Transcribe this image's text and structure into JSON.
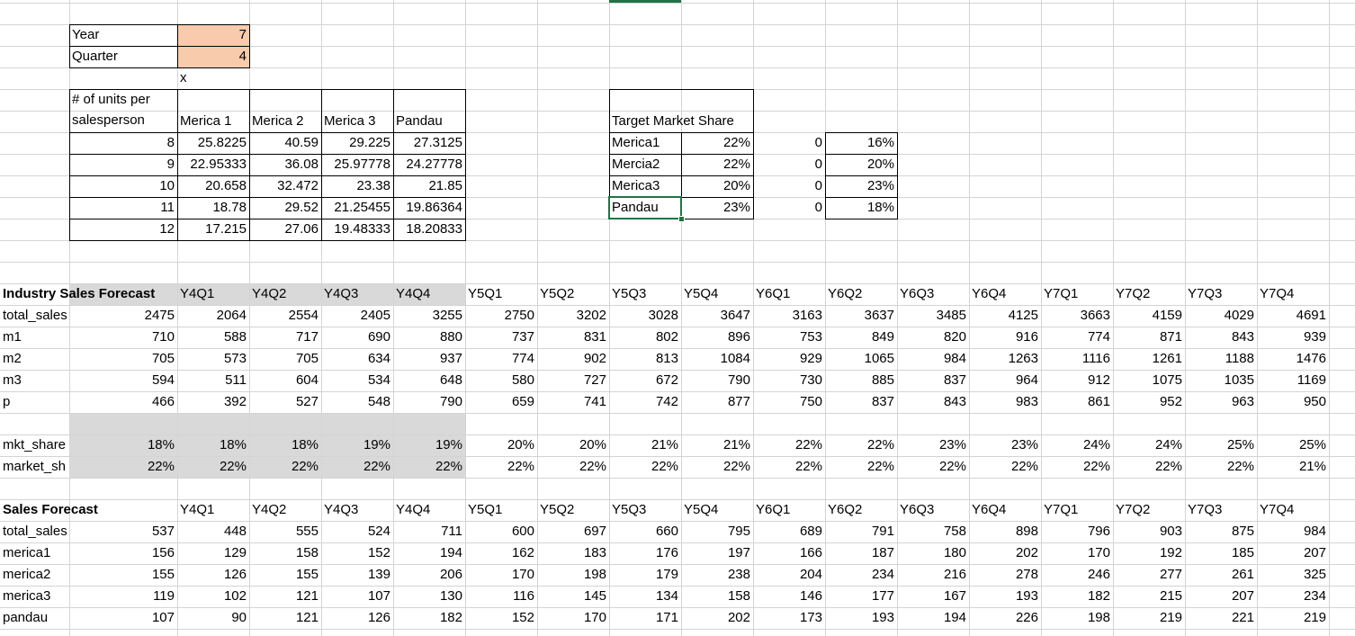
{
  "colors": {
    "input_fill": "#f8cbad",
    "gray_band": "#d9d9d9",
    "grid": "#d4d4d4",
    "selection": "#217346"
  },
  "inputs": {
    "year_label": "Year",
    "year_value": "7",
    "quarter_label": "Quarter",
    "quarter_value": "4",
    "x_marker": "x"
  },
  "units": {
    "header_label": "# of units per salesperson",
    "columns": [
      "Merica 1",
      "Merica 2",
      "Merica 3",
      "Pandau"
    ],
    "rows": [
      [
        "8",
        "25.8225",
        "40.59",
        "29.225",
        "27.3125"
      ],
      [
        "9",
        "22.95333",
        "36.08",
        "25.97778",
        "24.27778"
      ],
      [
        "10",
        "20.658",
        "32.472",
        "23.38",
        "21.85"
      ],
      [
        "11",
        "18.78",
        "29.52",
        "21.25455",
        "19.86364"
      ],
      [
        "12",
        "17.215",
        "27.06",
        "19.48333",
        "18.20833"
      ]
    ]
  },
  "target": {
    "title": "Target Market Share",
    "rows": [
      [
        "Merica1",
        "22%",
        "0",
        "16%"
      ],
      [
        "Mercia2",
        "22%",
        "0",
        "20%"
      ],
      [
        "Merica3",
        "20%",
        "0",
        "23%"
      ],
      [
        "Pandau",
        "23%",
        "0",
        "18%"
      ]
    ]
  },
  "industry": {
    "title": "Industry Sales Forecast",
    "headers": [
      "Y4Q1",
      "Y4Q2",
      "Y4Q3",
      "Y4Q4",
      "Y5Q1",
      "Y5Q2",
      "Y5Q3",
      "Y5Q4",
      "Y6Q1",
      "Y6Q2",
      "Y6Q3",
      "Y6Q4",
      "Y7Q1",
      "Y7Q2",
      "Y7Q3",
      "Y7Q4"
    ],
    "rows": [
      {
        "label": "total_sales",
        "values": [
          "2475",
          "2064",
          "2554",
          "2405",
          "3255",
          "2750",
          "3202",
          "3028",
          "3647",
          "3163",
          "3637",
          "3485",
          "4125",
          "3663",
          "4159",
          "4029",
          "4691"
        ]
      },
      {
        "label": "m1",
        "values": [
          "710",
          "588",
          "717",
          "690",
          "880",
          "737",
          "831",
          "802",
          "896",
          "753",
          "849",
          "820",
          "916",
          "774",
          "871",
          "843",
          "939"
        ]
      },
      {
        "label": "m2",
        "values": [
          "705",
          "573",
          "705",
          "634",
          "937",
          "774",
          "902",
          "813",
          "1084",
          "929",
          "1065",
          "984",
          "1263",
          "1116",
          "1261",
          "1188",
          "1476"
        ]
      },
      {
        "label": "m3",
        "values": [
          "594",
          "511",
          "604",
          "534",
          "648",
          "580",
          "727",
          "672",
          "790",
          "730",
          "885",
          "837",
          "964",
          "912",
          "1075",
          "1035",
          "1169"
        ]
      },
      {
        "label": "p",
        "values": [
          "466",
          "392",
          "527",
          "548",
          "790",
          "659",
          "741",
          "742",
          "877",
          "750",
          "837",
          "843",
          "983",
          "861",
          "952",
          "963",
          "950"
        ]
      }
    ],
    "share_rows": [
      {
        "label": "mkt_share",
        "values": [
          "18%",
          "18%",
          "18%",
          "19%",
          "19%",
          "20%",
          "20%",
          "21%",
          "21%",
          "22%",
          "22%",
          "23%",
          "23%",
          "24%",
          "24%",
          "25%",
          "25%"
        ]
      },
      {
        "label": "market_sh",
        "values": [
          "22%",
          "22%",
          "22%",
          "22%",
          "22%",
          "22%",
          "22%",
          "22%",
          "22%",
          "22%",
          "22%",
          "22%",
          "22%",
          "22%",
          "22%",
          "22%",
          "21%"
        ]
      }
    ]
  },
  "sales": {
    "title": "Sales Forecast",
    "headers": [
      "Y4Q1",
      "Y4Q2",
      "Y4Q3",
      "Y4Q4",
      "Y5Q1",
      "Y5Q2",
      "Y5Q3",
      "Y5Q4",
      "Y6Q1",
      "Y6Q2",
      "Y6Q3",
      "Y6Q4",
      "Y7Q1",
      "Y7Q2",
      "Y7Q3",
      "Y7Q4"
    ],
    "rows": [
      {
        "label": "total_sales",
        "values": [
          "537",
          "448",
          "555",
          "524",
          "711",
          "600",
          "697",
          "660",
          "795",
          "689",
          "791",
          "758",
          "898",
          "796",
          "903",
          "875",
          "984"
        ]
      },
      {
        "label": "merica1",
        "values": [
          "156",
          "129",
          "158",
          "152",
          "194",
          "162",
          "183",
          "176",
          "197",
          "166",
          "187",
          "180",
          "202",
          "170",
          "192",
          "185",
          "207"
        ]
      },
      {
        "label": "merica2",
        "values": [
          "155",
          "126",
          "155",
          "139",
          "206",
          "170",
          "198",
          "179",
          "238",
          "204",
          "234",
          "216",
          "278",
          "246",
          "277",
          "261",
          "325"
        ]
      },
      {
        "label": "merica3",
        "values": [
          "119",
          "102",
          "121",
          "107",
          "130",
          "116",
          "145",
          "134",
          "158",
          "146",
          "177",
          "167",
          "193",
          "182",
          "215",
          "207",
          "234"
        ]
      },
      {
        "label": "pandau",
        "values": [
          "107",
          "90",
          "121",
          "126",
          "182",
          "152",
          "170",
          "171",
          "202",
          "173",
          "193",
          "194",
          "226",
          "198",
          "219",
          "221",
          "219"
        ]
      }
    ]
  }
}
